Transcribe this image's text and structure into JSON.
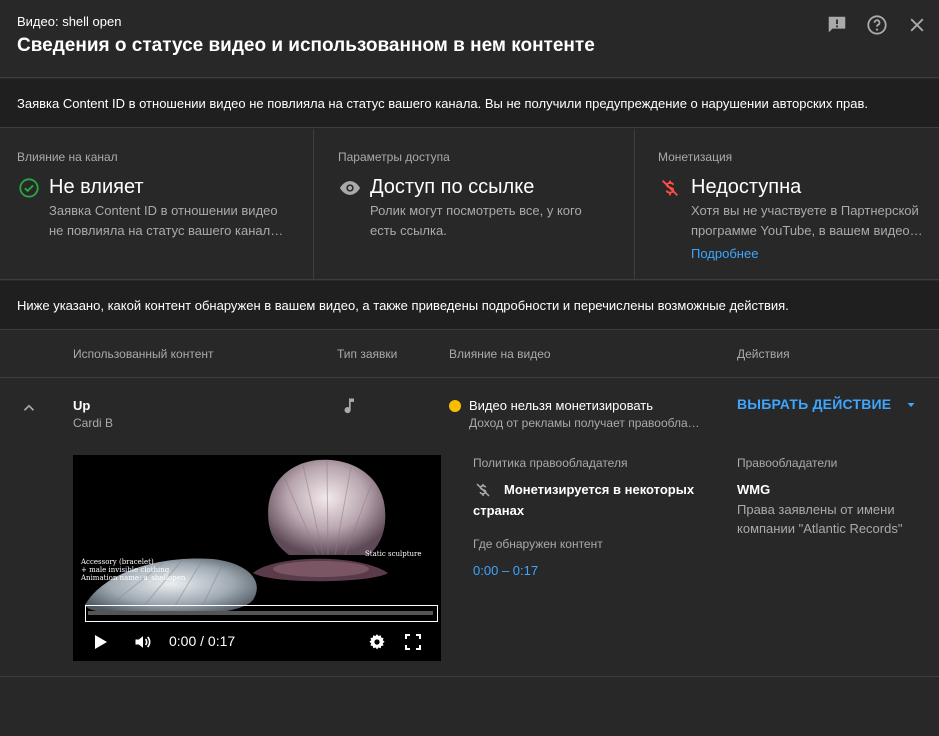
{
  "header": {
    "subtitle": "Видео: shell open",
    "title": "Сведения о статусе видео и использованном в нем контенте",
    "icons": [
      "feedback-icon",
      "help-icon",
      "close-icon"
    ]
  },
  "banner": {
    "text": "Заявка Content ID в отношении видео не повлияла на статус вашего канала. Вы не получили предупреждение о нарушении авторских прав."
  },
  "cards": [
    {
      "label": "Влияние на канал",
      "value": "Не влияет",
      "desc": "Заявка Content ID в отношении видео не повлияла на статус вашего канал…",
      "icon": "check-circle-icon",
      "icon_color": "#2ba640"
    },
    {
      "label": "Параметры доступа",
      "value": "Доступ по ссылке",
      "desc": "Ролик могут посмотреть все, у кого есть ссылка.",
      "icon": "eye-icon",
      "icon_color": "#aaaaaa"
    },
    {
      "label": "Монетизация",
      "value": "Недоступна",
      "desc": "Хотя вы не участвуете в Партнерской программе YouTube, в вашем видео…",
      "link": "Подробнее",
      "icon": "no-money-icon",
      "icon_color": "#ff4e45"
    }
  ],
  "info": {
    "text": "Ниже указано, какой контент обнаружен в вашем видео, а также приведены подробности и перечислены возможные действия."
  },
  "table": {
    "headers": [
      "Использованный контент",
      "Тип заявки",
      "Влияние на видео",
      "Действия"
    ],
    "row": {
      "title": "Up",
      "artist": "Cardi B",
      "claim_type_icon": "music-note-icon",
      "impact_title": "Видео нельзя монетизировать",
      "impact_desc": "Доход от рекламы получает правообла…",
      "impact_dot_color": "#f9be00",
      "action_label": "ВЫБРАТЬ ДЕЙСТВИЕ",
      "policy_label": "Политика правообладателя",
      "policy_line1": "Монетизируется в некоторых",
      "policy_line2": "странах",
      "found_label": "Где обнаружен контент",
      "found_range": "0:00 – 0:17",
      "owners_label": "Правообладатели",
      "owner_name": "WMG",
      "owner_desc_line1": "Права заявлены от имени",
      "owner_desc_line2": "компании \"Atlantic Records\""
    }
  },
  "video": {
    "overlay_left": [
      "Accessory (bracelet)",
      "+ male invisible clothing",
      "Animation name: a_shellopen"
    ],
    "overlay_right": "Static sculpture",
    "time": "0:00 / 0:17"
  },
  "colors": {
    "accent": "#3ea6ff",
    "background": "#282828",
    "panel": "#1f1f1f"
  }
}
